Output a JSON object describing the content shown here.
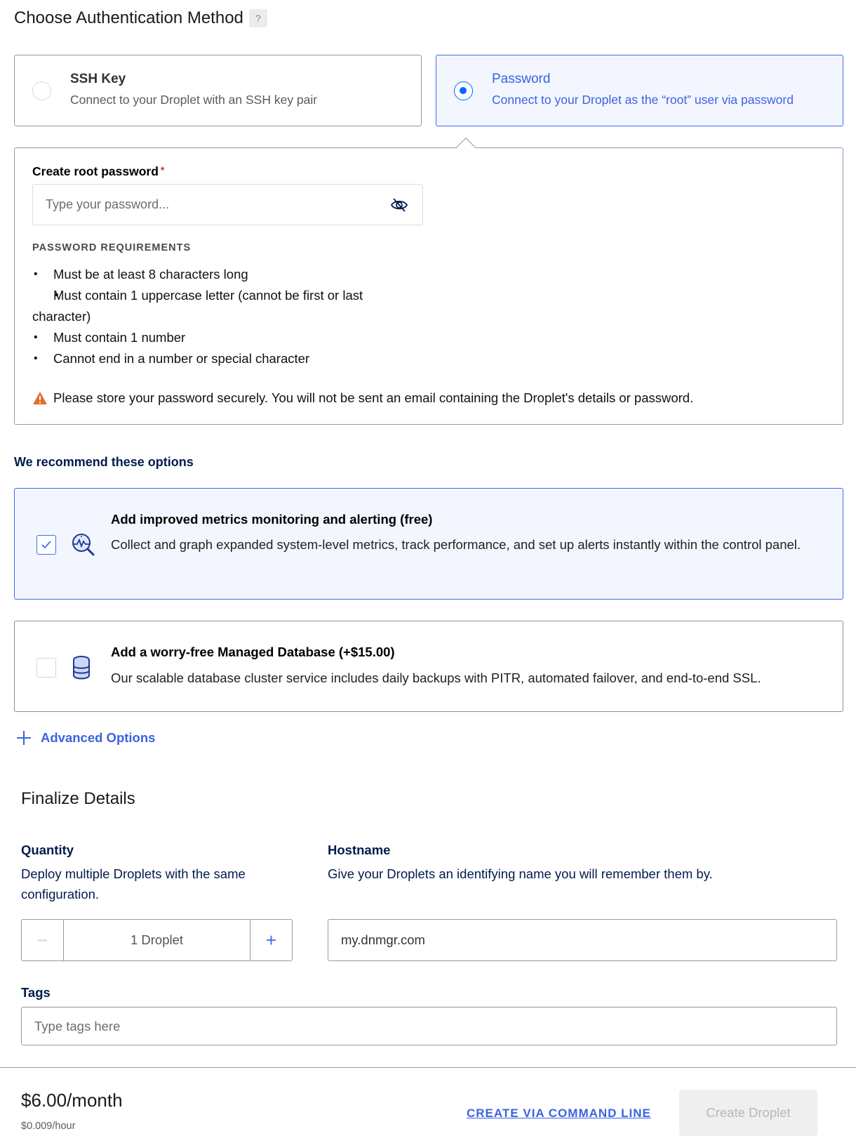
{
  "auth": {
    "title": "Choose Authentication Method",
    "help_label": "?",
    "options": [
      {
        "title": "SSH Key",
        "description": "Connect to your Droplet with an SSH key pair",
        "selected": false
      },
      {
        "title": "Password",
        "description": "Connect to your Droplet as the “root” user via password",
        "selected": true
      }
    ]
  },
  "password": {
    "label": "Create root password",
    "required_marker": "*",
    "placeholder": "Type your password...",
    "value": "",
    "toggle_icon": "eye-slash-icon",
    "requirements_heading": "PASSWORD REQUIREMENTS",
    "requirements": [
      "Must be at least 8 characters long",
      "Must contain 1 uppercase letter (cannot be first or last character)",
      "Must contain 1 number",
      "Cannot end in a number or special character"
    ],
    "warning_icon": "warning-triangle-icon",
    "warning": "Please store your password securely. You will not be sent an email containing the Droplet's details or password."
  },
  "recommend": {
    "heading": "We recommend these options",
    "options": [
      {
        "icon": "metrics-magnifier-icon",
        "title": "Add improved metrics monitoring and alerting (free)",
        "description": "Collect and graph expanded system-level metrics, track performance, and set up alerts instantly within the control panel.",
        "checked": true
      },
      {
        "icon": "database-icon",
        "title": "Add a worry-free Managed Database (+$15.00)",
        "description": "Our scalable database cluster service includes daily backups with PITR, automated failover, and end-to-end SSL.",
        "checked": false
      }
    ]
  },
  "advanced": {
    "label": "Advanced Options",
    "icon": "plus-icon"
  },
  "finalize": {
    "title": "Finalize Details",
    "quantity": {
      "label": "Quantity",
      "description": "Deploy multiple Droplets with the same configuration.",
      "value": "1  Droplet",
      "minus": "−",
      "plus": "+"
    },
    "hostname": {
      "label": "Hostname",
      "description": "Give your Droplets an identifying name you will remember them by.",
      "value": "my.dnmgr.com"
    },
    "tags": {
      "label": "Tags",
      "placeholder": "Type tags here",
      "value": ""
    }
  },
  "footer": {
    "price": "$6.00/month",
    "hourly": "$0.009/hour",
    "cli_link": "CREATE VIA COMMAND LINE",
    "create_button": "Create Droplet",
    "create_enabled": false
  },
  "colors": {
    "accent": "#3a63e0",
    "selected_bg": "#f3f6fe",
    "warning": "#e0702b",
    "text_dark": "#031b4e",
    "disabled_bg": "#efefef"
  }
}
